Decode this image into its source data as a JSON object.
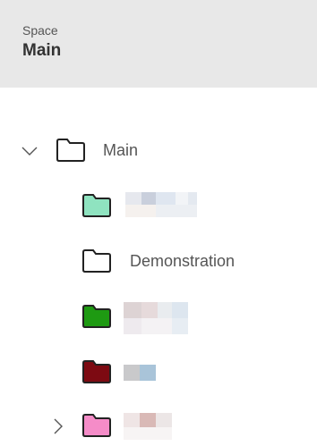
{
  "header": {
    "space_label": "Space",
    "space_title": "Main"
  },
  "tree": {
    "root": {
      "label": "Main",
      "expanded": true,
      "folder_color": "#ffffff",
      "toggle_icon": "chevron-down-icon"
    },
    "children": [
      {
        "label": "",
        "folder_color": "#8fe3c0",
        "label_redacted": true
      },
      {
        "label": "Demonstration",
        "folder_color": "#ffffff",
        "label_redacted": false
      },
      {
        "label": "",
        "folder_color": "#1e9a12",
        "label_redacted": true
      },
      {
        "label": "",
        "folder_color": "#7d0a12",
        "label_redacted": true
      },
      {
        "label": "",
        "folder_color": "#f58cc8",
        "label_redacted": true,
        "has_children": true,
        "toggle_icon": "chevron-right-icon"
      }
    ]
  }
}
